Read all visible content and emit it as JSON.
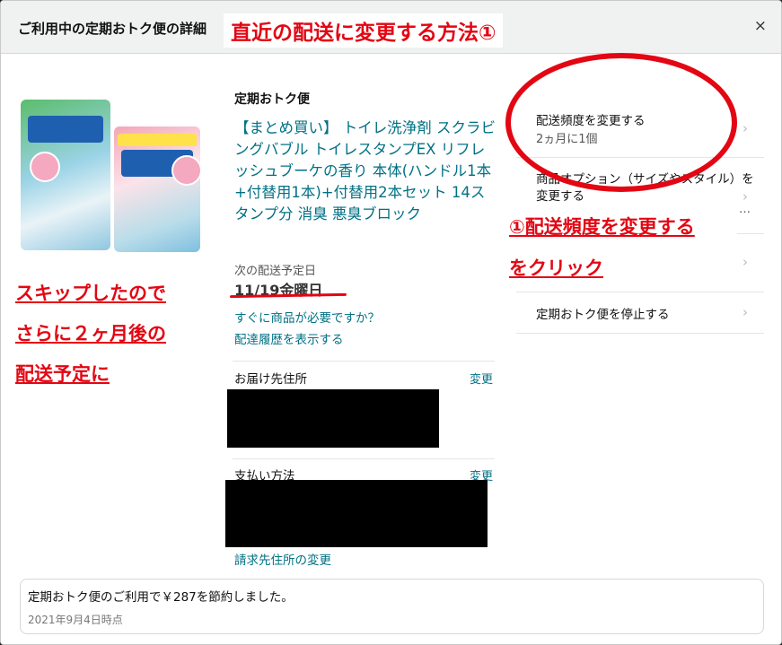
{
  "header": {
    "title": "ご利用中の定期おトク便の詳細",
    "close_label": "×"
  },
  "annotation": {
    "banner": "直近の配送に変更する方法①",
    "left_note": [
      "スキップしたので",
      "さらに２ヶ月後の",
      "配送予定に"
    ],
    "step": [
      "①配送頻度を変更する",
      "をクリック"
    ]
  },
  "product": {
    "section_title": "定期おトク便",
    "title": "【まとめ買い】 トイレ洗浄剤 スクラビングバブル トイレスタンプEX リフレッシュブーケの香り 本体(ハンドル1本+付替用1本)+付替用2本セット 14スタンプ分 消臭 悪臭ブロック",
    "next_delivery_label": "次の配送予定日",
    "next_delivery_date": "11/19金曜日",
    "need_now_link": "すぐに商品が必要ですか？",
    "history_link": "配達履歴を表示する"
  },
  "address": {
    "label": "お届け先住所",
    "change": "変更"
  },
  "payment": {
    "label": "支払い方法",
    "change": "変更",
    "billing_link": "請求先住所の変更"
  },
  "options": [
    {
      "label": "配送頻度を変更する",
      "sub": "2ヵ月に1個"
    },
    {
      "label": "商品オプション（サイズやスタイル）を",
      "label2": "変更する",
      "sub": "…"
    },
    {
      "label": ""
    },
    {
      "label": "定期おトク便を停止する"
    }
  ],
  "savings": {
    "text": "定期おトク便のご利用で￥287を節約しました。",
    "date": "2021年9月4日時点"
  },
  "colors": {
    "annotation_red": "#e30613",
    "link_teal": "#007185"
  }
}
